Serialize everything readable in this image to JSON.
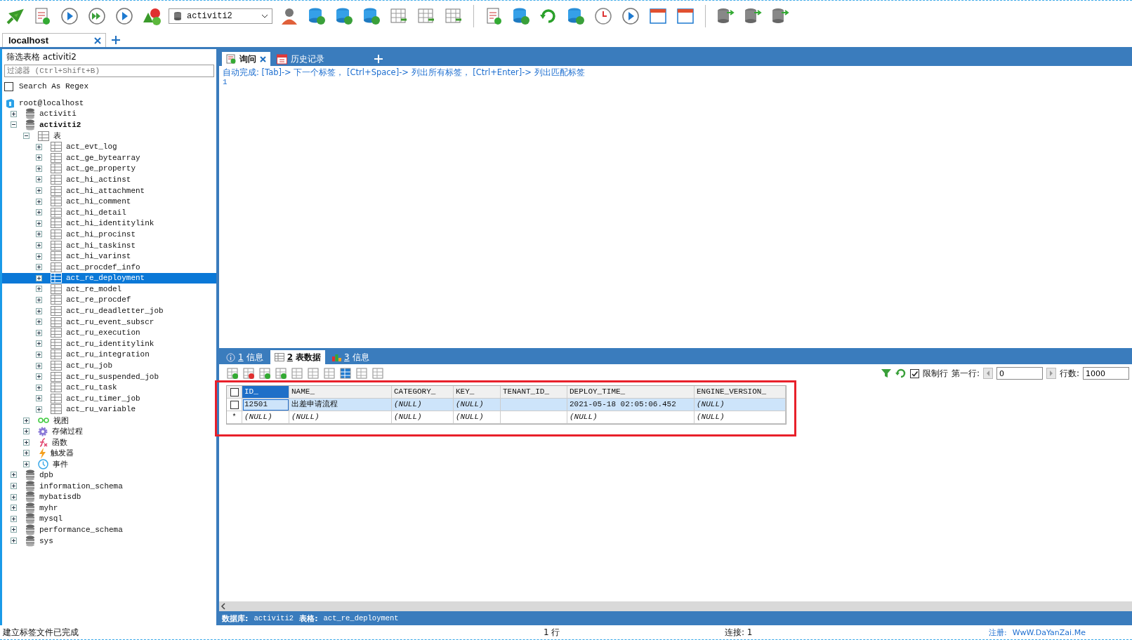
{
  "toolbar": {
    "database_select": "activiti2"
  },
  "connection_tabs": [
    {
      "label": "localhost",
      "selected": true
    }
  ],
  "sidebar": {
    "title": "筛选表格 activiti2",
    "filter": {
      "placeholder": "过滤器 (Ctrl+Shift+B)"
    },
    "regex": {
      "label": "Search As Regex",
      "checked": false
    },
    "tree": [
      {
        "label": "root@localhost",
        "kind": "server",
        "expanded": true,
        "selected": false,
        "children": [
          {
            "label": "activiti",
            "kind": "database",
            "active": false,
            "expanded": false,
            "selected": false
          },
          {
            "label": "activiti2",
            "kind": "database",
            "active": true,
            "expanded": true,
            "selected": false,
            "children": [
              {
                "label": "表",
                "kind": "tables",
                "expanded": true,
                "selected": false,
                "children": [
                  {
                    "label": "act_evt_log",
                    "kind": "table",
                    "expanded": false,
                    "selected": false
                  },
                  {
                    "label": "act_ge_bytearray",
                    "kind": "table",
                    "expanded": false,
                    "selected": false
                  },
                  {
                    "label": "act_ge_property",
                    "kind": "table",
                    "expanded": false,
                    "selected": false
                  },
                  {
                    "label": "act_hi_actinst",
                    "kind": "table",
                    "expanded": false,
                    "selected": false
                  },
                  {
                    "label": "act_hi_attachment",
                    "kind": "table",
                    "expanded": false,
                    "selected": false
                  },
                  {
                    "label": "act_hi_comment",
                    "kind": "table",
                    "expanded": false,
                    "selected": false
                  },
                  {
                    "label": "act_hi_detail",
                    "kind": "table",
                    "expanded": false,
                    "selected": false
                  },
                  {
                    "label": "act_hi_identitylink",
                    "kind": "table",
                    "expanded": false,
                    "selected": false
                  },
                  {
                    "label": "act_hi_procinst",
                    "kind": "table",
                    "expanded": false,
                    "selected": false
                  },
                  {
                    "label": "act_hi_taskinst",
                    "kind": "table",
                    "expanded": false,
                    "selected": false
                  },
                  {
                    "label": "act_hi_varinst",
                    "kind": "table",
                    "expanded": false,
                    "selected": false
                  },
                  {
                    "label": "act_procdef_info",
                    "kind": "table",
                    "expanded": false,
                    "selected": false
                  },
                  {
                    "label": "act_re_deployment",
                    "kind": "table",
                    "expanded": false,
                    "selected": true
                  },
                  {
                    "label": "act_re_model",
                    "kind": "table",
                    "expanded": false,
                    "selected": false
                  },
                  {
                    "label": "act_re_procdef",
                    "kind": "table",
                    "expanded": false,
                    "selected": false
                  },
                  {
                    "label": "act_ru_deadletter_job",
                    "kind": "table",
                    "expanded": false,
                    "selected": false
                  },
                  {
                    "label": "act_ru_event_subscr",
                    "kind": "table",
                    "expanded": false,
                    "selected": false
                  },
                  {
                    "label": "act_ru_execution",
                    "kind": "table",
                    "expanded": false,
                    "selected": false
                  },
                  {
                    "label": "act_ru_identitylink",
                    "kind": "table",
                    "expanded": false,
                    "selected": false
                  },
                  {
                    "label": "act_ru_integration",
                    "kind": "table",
                    "expanded": false,
                    "selected": false
                  },
                  {
                    "label": "act_ru_job",
                    "kind": "table",
                    "expanded": false,
                    "selected": false
                  },
                  {
                    "label": "act_ru_suspended_job",
                    "kind": "table",
                    "expanded": false,
                    "selected": false
                  },
                  {
                    "label": "act_ru_task",
                    "kind": "table",
                    "expanded": false,
                    "selected": false
                  },
                  {
                    "label": "act_ru_timer_job",
                    "kind": "table",
                    "expanded": false,
                    "selected": false
                  },
                  {
                    "label": "act_ru_variable",
                    "kind": "table",
                    "expanded": false,
                    "selected": false
                  }
                ]
              },
              {
                "label": "视图",
                "kind": "view",
                "expanded": false,
                "selected": false
              },
              {
                "label": "存储过程",
                "kind": "procedure",
                "expanded": false,
                "selected": false
              },
              {
                "label": "函数",
                "kind": "function",
                "expanded": false,
                "selected": false
              },
              {
                "label": "触发器",
                "kind": "trigger",
                "expanded": false,
                "selected": false
              },
              {
                "label": "事件",
                "kind": "event",
                "expanded": false,
                "selected": false
              }
            ]
          },
          {
            "label": "dpb",
            "kind": "database",
            "active": false,
            "expanded": false,
            "selected": false
          },
          {
            "label": "information_schema",
            "kind": "database",
            "active": false,
            "expanded": false,
            "selected": false
          },
          {
            "label": "mybatisdb",
            "kind": "database",
            "active": false,
            "expanded": false,
            "selected": false
          },
          {
            "label": "myhr",
            "kind": "database",
            "active": false,
            "expanded": false,
            "selected": false
          },
          {
            "label": "mysql",
            "kind": "database",
            "active": false,
            "expanded": false,
            "selected": false
          },
          {
            "label": "performance_schema",
            "kind": "database",
            "active": false,
            "expanded": false,
            "selected": false
          },
          {
            "label": "sys",
            "kind": "database",
            "active": false,
            "expanded": false,
            "selected": false
          }
        ]
      }
    ]
  },
  "query_tabs": [
    {
      "label": "询问",
      "kind": "query",
      "selected": true
    },
    {
      "label": "历史记录",
      "kind": "history",
      "selected": false
    }
  ],
  "editor": {
    "hint": "自动完成: [Tab]-> 下一个标签， [Ctrl+Space]-> 列出所有标签， [Ctrl+Enter]-> 列出匹配标签",
    "line_numbers": [
      "1"
    ]
  },
  "result_tabs": [
    {
      "number": "1",
      "label": "信息",
      "kind": "info",
      "selected": false
    },
    {
      "number": "2",
      "label": "表数据",
      "kind": "table",
      "selected": true
    },
    {
      "number": "3",
      "label": "信息",
      "kind": "chart",
      "selected": false
    }
  ],
  "grid_toolbar": {
    "limit": {
      "label": "限制行",
      "checked": true
    },
    "first_row": {
      "label": "第一行:",
      "value": "0"
    },
    "row_count": {
      "label": "行数:",
      "value": "1000"
    }
  },
  "grid": {
    "all_checked": false,
    "columns": [
      {
        "label": "ID_",
        "selected": true
      },
      {
        "label": "NAME_",
        "selected": false
      },
      {
        "label": "CATEGORY_",
        "selected": false
      },
      {
        "label": "KEY_",
        "selected": false
      },
      {
        "label": "TENANT_ID_",
        "selected": false
      },
      {
        "label": "DEPLOY_TIME_",
        "selected": false
      },
      {
        "label": "ENGINE_VERSION_",
        "selected": false
      }
    ],
    "rows": [
      {
        "kind": "data",
        "checked": false,
        "selected": true,
        "cells": [
          {
            "text": "12501",
            "null": false
          },
          {
            "text": "出差申请流程",
            "null": false
          },
          {
            "text": "(NULL)",
            "null": true
          },
          {
            "text": "(NULL)",
            "null": true
          },
          {},
          {
            "text": "2021-05-18 02:05:06.452",
            "null": false
          },
          {
            "text": "(NULL)",
            "null": true
          }
        ]
      },
      {
        "kind": "new",
        "marker": "*",
        "selected": false,
        "cells": [
          {
            "text": "(NULL)",
            "null": true
          },
          {
            "text": "(NULL)",
            "null": true
          },
          {
            "text": "(NULL)",
            "null": true
          },
          {
            "text": "(NULL)",
            "null": true
          },
          {},
          {
            "text": "(NULL)",
            "null": true
          },
          {
            "text": "(NULL)",
            "null": true
          }
        ]
      }
    ]
  },
  "info_bar": {
    "database_label": "数据库:",
    "database": "activiti2",
    "table_label": "表格:",
    "table": "act_re_deployment"
  },
  "status_bar": {
    "message": "建立标签文件已完成",
    "rows": "1 行",
    "connections": "连接: 1",
    "register_label": "注册:",
    "register_link": "WwW.DaYanZai.Me"
  }
}
